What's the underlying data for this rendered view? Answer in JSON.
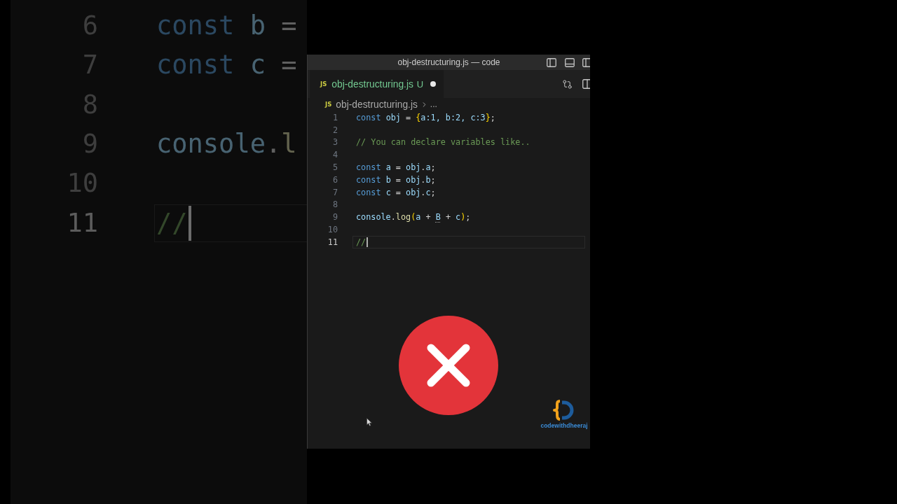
{
  "backdrop": {
    "lines": [
      {
        "number": "6",
        "active": false,
        "tokens": [
          {
            "text": "const ",
            "kind": "keyword"
          },
          {
            "text": "b",
            "kind": "variable"
          },
          {
            "text": " =",
            "kind": "plain"
          }
        ]
      },
      {
        "number": "7",
        "active": false,
        "tokens": [
          {
            "text": "const ",
            "kind": "keyword"
          },
          {
            "text": "c",
            "kind": "variable"
          },
          {
            "text": " =",
            "kind": "plain"
          }
        ]
      },
      {
        "number": "8",
        "active": false
      },
      {
        "number": "9",
        "active": false,
        "tokens": [
          {
            "text": "console",
            "kind": "variable"
          },
          {
            "text": ".",
            "kind": "plain"
          },
          {
            "text": "l",
            "kind": "function"
          }
        ]
      },
      {
        "number": "10",
        "active": false
      },
      {
        "number": "11",
        "active": true,
        "tokens": [
          {
            "text": "//",
            "kind": "comment"
          }
        ]
      }
    ]
  },
  "window": {
    "title": "obj-destructuring.js — code"
  },
  "tabs": [
    {
      "file_type": "JS",
      "label": "obj-destructuring.js",
      "git_status": "U",
      "modified": true,
      "selected": true
    }
  ],
  "breadcrumbs": {
    "file_type": "JS",
    "file": "obj-destructuring.js",
    "more": "..."
  },
  "editor": {
    "lines": [
      {
        "number": "1",
        "active": false,
        "tokens": [
          {
            "text": "const ",
            "kind": "keyword"
          },
          {
            "text": "obj",
            "kind": "variable"
          },
          {
            "text": " = ",
            "kind": "plain"
          },
          {
            "text": "{",
            "kind": "bracket"
          },
          {
            "text": "a:1, b:2, c:3",
            "kind": "property"
          },
          {
            "text": "}",
            "kind": "bracket"
          },
          {
            "text": ";",
            "kind": "plain"
          }
        ]
      },
      {
        "number": "2",
        "active": false
      },
      {
        "number": "3",
        "active": false,
        "tokens": [
          {
            "text": "// You can declare variables like..",
            "kind": "comment"
          }
        ]
      },
      {
        "number": "4",
        "active": false
      },
      {
        "number": "5",
        "active": false,
        "tokens": [
          {
            "text": "const ",
            "kind": "keyword"
          },
          {
            "text": "a",
            "kind": "variable"
          },
          {
            "text": " = ",
            "kind": "plain"
          },
          {
            "text": "obj",
            "kind": "variable"
          },
          {
            "text": ".",
            "kind": "plain"
          },
          {
            "text": "a",
            "kind": "variable"
          },
          {
            "text": ";",
            "kind": "plain"
          }
        ]
      },
      {
        "number": "6",
        "active": false,
        "tokens": [
          {
            "text": "const ",
            "kind": "keyword"
          },
          {
            "text": "b",
            "kind": "variable"
          },
          {
            "text": " = ",
            "kind": "plain"
          },
          {
            "text": "obj",
            "kind": "variable"
          },
          {
            "text": ".",
            "kind": "plain"
          },
          {
            "text": "b",
            "kind": "variable"
          },
          {
            "text": ";",
            "kind": "plain"
          }
        ]
      },
      {
        "number": "7",
        "active": false,
        "tokens": [
          {
            "text": "const ",
            "kind": "keyword"
          },
          {
            "text": "c",
            "kind": "variable"
          },
          {
            "text": " = ",
            "kind": "plain"
          },
          {
            "text": "obj",
            "kind": "variable"
          },
          {
            "text": ".",
            "kind": "plain"
          },
          {
            "text": "c",
            "kind": "variable"
          },
          {
            "text": ";",
            "kind": "plain"
          }
        ]
      },
      {
        "number": "8",
        "active": false
      },
      {
        "number": "9",
        "active": false,
        "tokens": [
          {
            "text": "console",
            "kind": "variable"
          },
          {
            "text": ".",
            "kind": "plain"
          },
          {
            "text": "log",
            "kind": "function"
          },
          {
            "text": "(",
            "kind": "bracket"
          },
          {
            "text": "a",
            "kind": "variable"
          },
          {
            "text": " + ",
            "kind": "plain"
          },
          {
            "text": "B",
            "kind": "warning"
          },
          {
            "text": " + ",
            "kind": "plain"
          },
          {
            "text": "c",
            "kind": "variable"
          },
          {
            "text": ")",
            "kind": "bracket"
          },
          {
            "text": ";",
            "kind": "plain"
          }
        ]
      },
      {
        "number": "10",
        "active": false
      },
      {
        "number": "11",
        "active": true,
        "tokens": [
          {
            "text": "//",
            "kind": "comment"
          }
        ]
      }
    ]
  },
  "channel_logo": {
    "caption": "codewithdheeraj"
  }
}
